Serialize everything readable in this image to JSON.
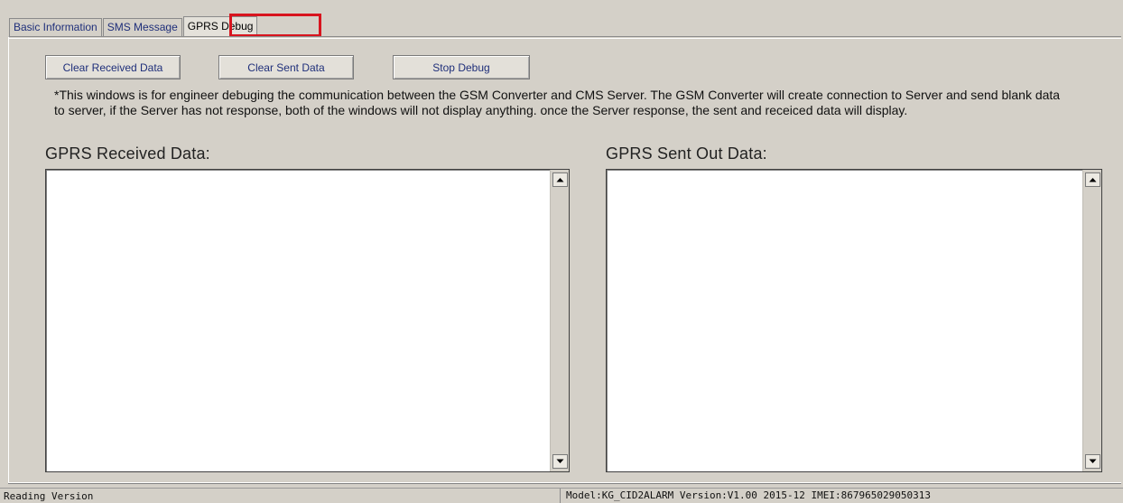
{
  "tabs": [
    {
      "label": "Basic Information",
      "active": false
    },
    {
      "label": "SMS Message",
      "active": false
    },
    {
      "label": "GPRS Debug",
      "active": true
    }
  ],
  "highlight_color": "#d8141e",
  "buttons": {
    "clear_received": "Clear Received Data",
    "clear_sent": "Clear Sent Data",
    "stop_debug": "Stop Debug"
  },
  "notice": "*This windows is for engineer debuging the communication between the GSM Converter and CMS Server. The GSM Converter will create connection to Server and send blank data to server, if the Server has not response, both of the windows will not display anything. once the Server response, the sent and receiced data will display.",
  "received": {
    "label": "GPRS Received Data:",
    "content": ""
  },
  "sent": {
    "label": "GPRS Sent Out Data:",
    "content": ""
  },
  "status": {
    "left": "Reading Version",
    "right": "Model:KG_CID2ALARM Version:V1.00 2015-12 IMEI:867965029050313"
  }
}
